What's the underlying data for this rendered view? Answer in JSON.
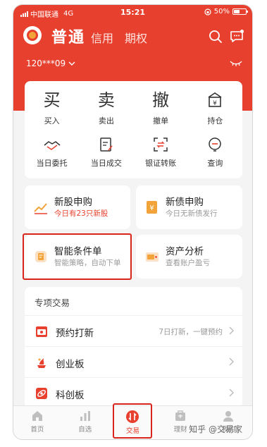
{
  "status_bar": {
    "carrier": "中国联通",
    "network": "4G",
    "time": "15:21",
    "battery": "50%",
    "battery_level": 0.5
  },
  "header": {
    "tabs": [
      {
        "label": "普通",
        "active": true
      },
      {
        "label": "信用",
        "active": false
      },
      {
        "label": "期权",
        "active": false
      }
    ],
    "account": "120***09",
    "icons": [
      "search-icon",
      "message-icon",
      "hide-eye-icon"
    ]
  },
  "actions_primary": [
    {
      "glyph": "买",
      "label": "买入"
    },
    {
      "glyph": "卖",
      "label": "卖出"
    },
    {
      "glyph": "撤",
      "label": "撤单"
    },
    {
      "label": "持仓",
      "icon": "position-icon"
    }
  ],
  "actions_secondary": [
    {
      "label": "当日委托",
      "icon": "handshake-icon"
    },
    {
      "label": "当日成交",
      "icon": "edit-doc-icon"
    },
    {
      "label": "银证转账",
      "icon": "transfer-icon"
    },
    {
      "label": "查询",
      "icon": "query-icon"
    }
  ],
  "features": [
    {
      "title": "新股申购",
      "subtitle": "今日有23只新股",
      "icon": "chart-up-icon",
      "subtitle_red": true
    },
    {
      "title": "新债申购",
      "subtitle": "今日无新债发行",
      "icon": "bond-icon",
      "subtitle_red": false
    },
    {
      "title": "智能条件单",
      "subtitle": "智能策略，自动下单",
      "icon": "smart-order-icon",
      "subtitle_red": false
    },
    {
      "title": "资产分析",
      "subtitle": "查看账户盈亏",
      "icon": "wallet-icon",
      "subtitle_red": false
    }
  ],
  "special": {
    "heading": "专项交易",
    "rows": [
      {
        "label": "预约打新",
        "right": "7日打新，一键预约",
        "icon": "calendar-icon"
      },
      {
        "label": "创业板",
        "right": "",
        "icon": "growth-board-icon"
      },
      {
        "label": "科创板",
        "right": "",
        "icon": "star-board-icon"
      }
    ]
  },
  "tabbar": [
    {
      "label": "首页",
      "icon": "home-icon",
      "active": false
    },
    {
      "label": "自选",
      "icon": "bars-icon",
      "active": false
    },
    {
      "label": "交易",
      "icon": "trade-icon",
      "active": true
    },
    {
      "label": "理财",
      "icon": "bag-icon",
      "active": false
    },
    {
      "label": "我的",
      "icon": "user-icon",
      "active": false
    }
  ],
  "watermark": "知乎 @交易家",
  "colors": {
    "brand_red": "#e8402e",
    "highlight_box": "#d9261c",
    "accent_orange": "#f2a43a"
  }
}
